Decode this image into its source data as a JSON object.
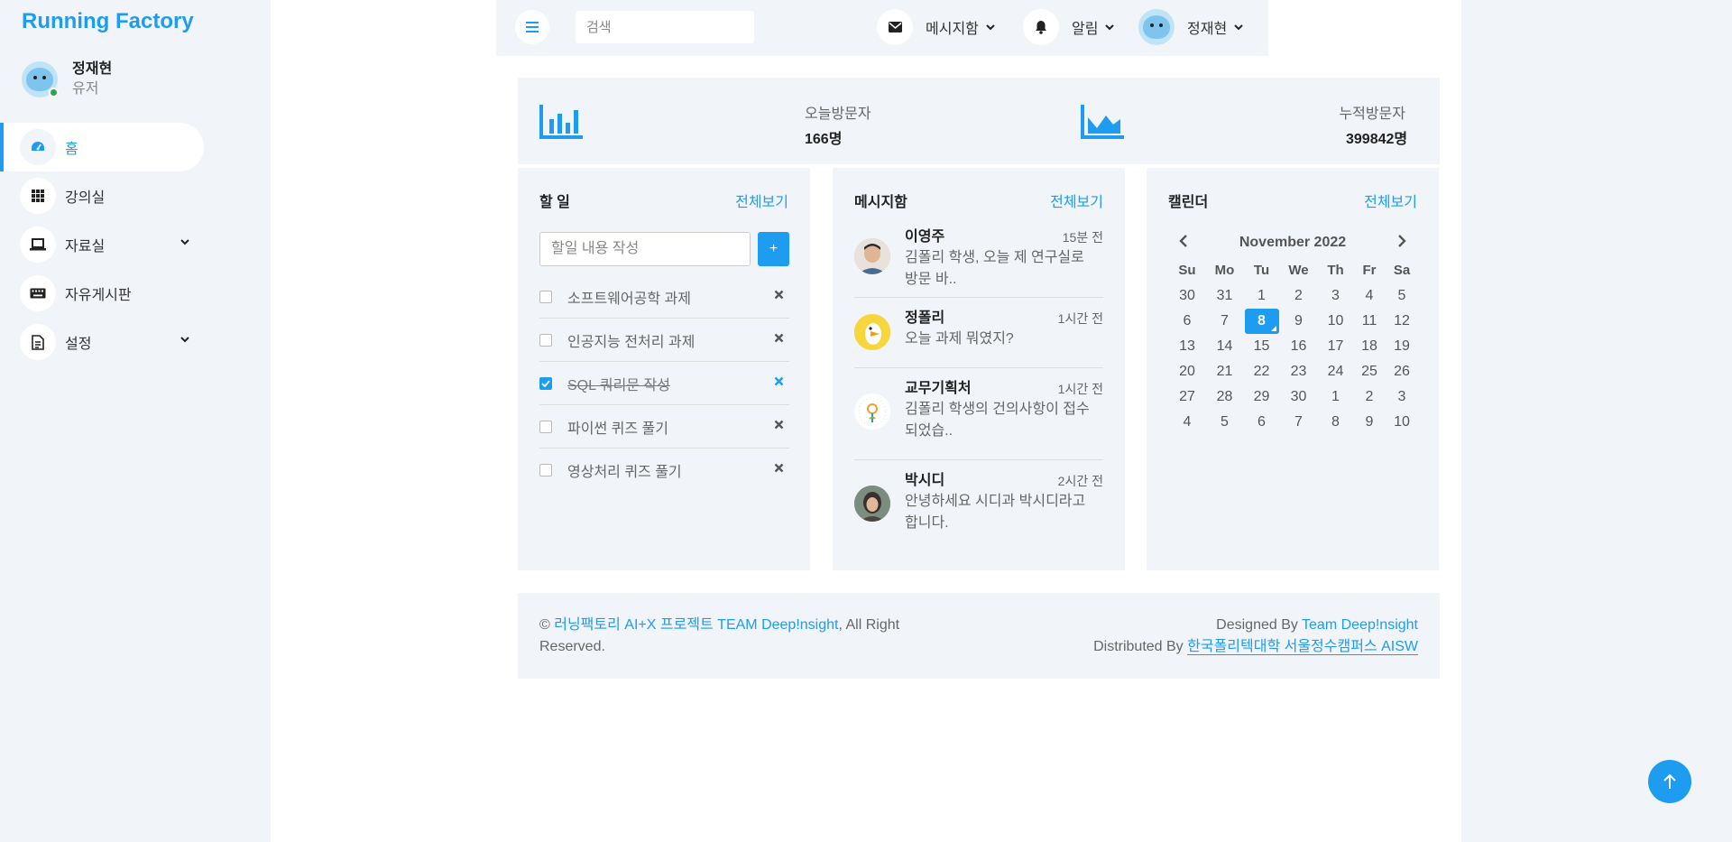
{
  "brand": "Running Factory",
  "profile": {
    "name": "정재현",
    "role": "유저"
  },
  "sidebar": {
    "items": [
      {
        "label": "홈",
        "icon": "dashboard-icon",
        "active": true
      },
      {
        "label": "강의실",
        "icon": "grid-icon"
      },
      {
        "label": "자료실",
        "icon": "laptop-icon",
        "expandable": true
      },
      {
        "label": "자유게시판",
        "icon": "keyboard-icon"
      },
      {
        "label": "설정",
        "icon": "document-icon",
        "expandable": true
      }
    ]
  },
  "topbar": {
    "search_placeholder": "검색",
    "messages_label": "메시지함",
    "alerts_label": "알림",
    "user_label": "정재현"
  },
  "stats": {
    "today_label": "오늘방문자",
    "today_value": "166명",
    "total_label": "누적방문자",
    "total_value": "399842명"
  },
  "todo": {
    "title": "할 일",
    "view_all": "전체보기",
    "input_placeholder": "할일 내용 작성",
    "add_label": "+",
    "items": [
      {
        "text": "소프트웨어공학 과제",
        "done": false
      },
      {
        "text": "인공지능 전처리 과제",
        "done": false
      },
      {
        "text": "SQL 쿼리문 작성",
        "done": true
      },
      {
        "text": "파이썬 퀴즈 풀기",
        "done": false
      },
      {
        "text": "영상처리 퀴즈 풀기",
        "done": false
      }
    ]
  },
  "messages": {
    "title": "메시지함",
    "view_all": "전체보기",
    "items": [
      {
        "name": "이영주",
        "time": "15분 전",
        "line1": "김폴리 학생, 오늘 제 연구실로",
        "line2": "방문 바.."
      },
      {
        "name": "정폴리",
        "time": "1시간 전",
        "line1": "오늘 과제 뭐였지?",
        "line2": ""
      },
      {
        "name": "교무기획처",
        "time": "1시간 전",
        "line1": "김폴리 학생의 건의사항이 접수",
        "line2": "되었습.."
      },
      {
        "name": "박시디",
        "time": "2시간 전",
        "line1": "안녕하세요 시디과 박시디라고",
        "line2": "합니다."
      }
    ]
  },
  "calendar": {
    "title": "캘린더",
    "view_all": "전체보기",
    "month": "November 2022",
    "weekdays": [
      "Su",
      "Mo",
      "Tu",
      "We",
      "Th",
      "Fr",
      "Sa"
    ],
    "weeks": [
      [
        "30",
        "31",
        "1",
        "2",
        "3",
        "4",
        "5"
      ],
      [
        "6",
        "7",
        "8",
        "9",
        "10",
        "11",
        "12"
      ],
      [
        "13",
        "14",
        "15",
        "16",
        "17",
        "18",
        "19"
      ],
      [
        "20",
        "21",
        "22",
        "23",
        "24",
        "25",
        "26"
      ],
      [
        "27",
        "28",
        "29",
        "30",
        "1",
        "2",
        "3"
      ],
      [
        "4",
        "5",
        "6",
        "7",
        "8",
        "9",
        "10"
      ]
    ],
    "selected": "8"
  },
  "footer": {
    "copyright": "© ",
    "project_link": "러닝팩토리 AI+X 프로젝트 TEAM Deep!nsight",
    "rights": ", All Right Reserved.",
    "designed_by": "Designed By ",
    "designer_link": "Team Deep!nsight",
    "distributed_by": "Distributed By ",
    "distributor_link": "한국폴리텍대학 서울정수캠퍼스 AISW"
  },
  "colors": {
    "accent": "#1e9cf0",
    "panel": "#f1f4f8"
  }
}
